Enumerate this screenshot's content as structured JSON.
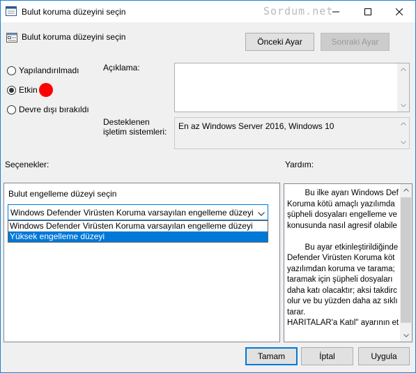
{
  "window": {
    "title": "Bulut koruma düzeyini seçin",
    "watermark": "Sordum.net"
  },
  "header": {
    "title": "Bulut koruma düzeyini seçin",
    "prev_label": "Önceki Ayar",
    "next_label": "Sonraki Ayar"
  },
  "state": {
    "options": [
      {
        "label": "Yapılandırılmadı",
        "selected": false
      },
      {
        "label": "Etkin",
        "selected": true
      },
      {
        "label": "Devre dışı bırakıldı",
        "selected": false
      }
    ]
  },
  "comment": {
    "label": "Açıklama:",
    "value": ""
  },
  "supported": {
    "label_line1": "Desteklenen",
    "label_line2": "işletim sistemleri:",
    "value": "En az Windows Server 2016, Windows 10"
  },
  "sections": {
    "options_label": "Seçenekler:",
    "help_label": "Yardım:"
  },
  "options_panel": {
    "field_label": "Bulut engelleme düzeyi seçin",
    "selected_value": "Windows Defender Virüsten Koruma varsayılan engelleme düzeyi",
    "dropdown_options": [
      "Windows Defender Virüsten Koruma varsayılan engelleme düzeyi",
      "Yüksek engelleme düzeyi"
    ],
    "highlighted_index": 1
  },
  "help": {
    "lines": [
      "        Bu ilke ayarı Windows Defe",
      "Koruma kötü amaçlı yazılımda",
      "şüpheli dosyaları engelleme ve",
      "konusunda nasıl agresif olabile",
      "",
      "        Bu ayar etkinleştirildiğinde,",
      "Defender Virüsten Koruma köt",
      "yazılımdan koruma ve tarama;",
      "taramak için şüpheli dosyaları",
      "daha katı olacaktır; aksi takdirc",
      "olur ve bu yüzden daha az sıklı",
      "tarar.",
      "HARITALAR'a Katıl\" ayarının et"
    ]
  },
  "footer": {
    "ok_label": "Tamam",
    "cancel_label": "İptal",
    "apply_label": "Uygula"
  },
  "colors": {
    "accent": "#0078d7",
    "marker": "#ff0000"
  }
}
